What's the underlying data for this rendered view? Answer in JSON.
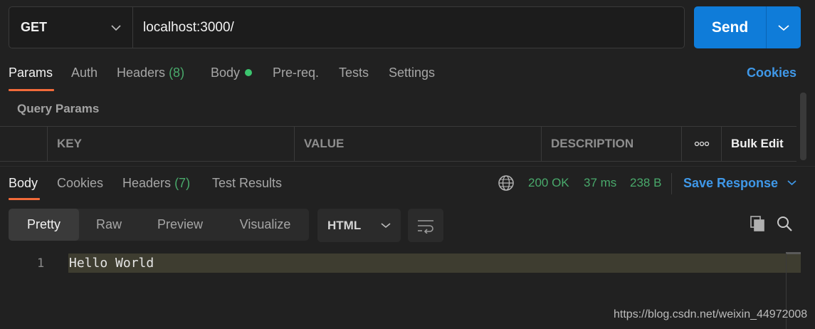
{
  "request": {
    "method": "GET",
    "url": "localhost:3000/",
    "send_label": "Send"
  },
  "request_tabs": {
    "params": "Params",
    "auth": "Auth",
    "headers": "Headers",
    "headers_count": "(8)",
    "body": "Body",
    "prereq": "Pre-req.",
    "tests": "Tests",
    "settings": "Settings",
    "cookies": "Cookies"
  },
  "query_params": {
    "title": "Query Params",
    "columns": [
      "KEY",
      "VALUE",
      "DESCRIPTION"
    ],
    "more": "ooo",
    "bulk_edit": "Bulk Edit"
  },
  "response_tabs": {
    "body": "Body",
    "cookies": "Cookies",
    "headers": "Headers",
    "headers_count": "(7)",
    "test_results": "Test Results"
  },
  "response_status": {
    "status": "200 OK",
    "time": "37 ms",
    "size": "238 B",
    "save_response": "Save Response"
  },
  "response_view": {
    "modes": [
      "Pretty",
      "Raw",
      "Preview",
      "Visualize"
    ],
    "active_mode": "Pretty",
    "format": "HTML"
  },
  "editor": {
    "lines": [
      {
        "number": "1",
        "text": "Hello World"
      }
    ]
  },
  "watermark": "https://blog.csdn.net/weixin_44972008",
  "colors": {
    "accent_orange": "#f26b3a",
    "send_blue": "#0f7cd9",
    "link_blue": "#3f98e8",
    "success_green": "#49a96b"
  }
}
